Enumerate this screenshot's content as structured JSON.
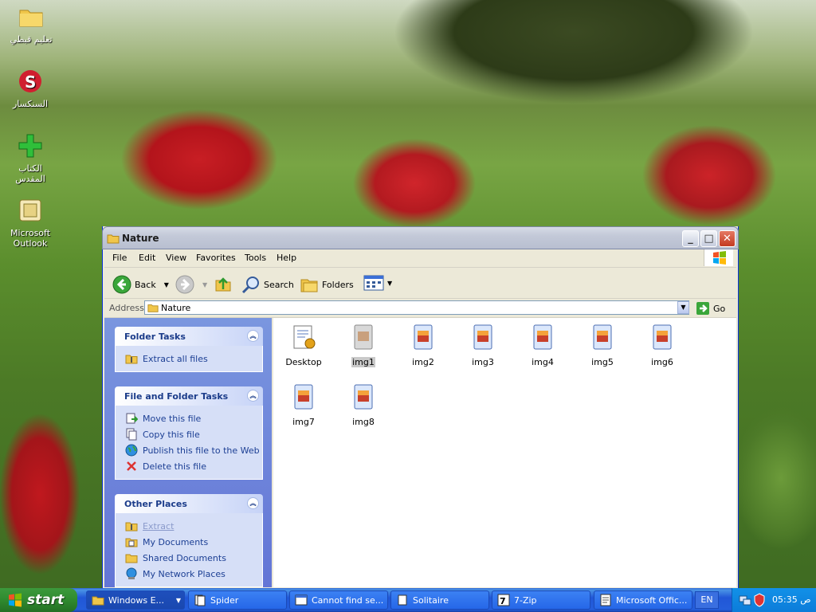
{
  "desktop": {
    "icons": [
      {
        "label": "تعليم قبطي",
        "icon": "folder-icon"
      },
      {
        "label": "السنكسار",
        "icon": "s-app-icon"
      },
      {
        "label": "الكتاب المقدس",
        "icon": "bible-app-icon"
      },
      {
        "label": "Microsoft Outlook",
        "icon": "outlook-icon"
      }
    ]
  },
  "window": {
    "title": "Nature",
    "menu": [
      "File",
      "Edit",
      "View",
      "Favorites",
      "Tools",
      "Help"
    ],
    "toolbar": {
      "back": "Back",
      "search": "Search",
      "folders": "Folders"
    },
    "address": {
      "label": "Address",
      "value": "Nature",
      "go": "Go"
    },
    "panels": {
      "folder_tasks": {
        "title": "Folder Tasks",
        "items": [
          "Extract all files"
        ]
      },
      "file_folder_tasks": {
        "title": "File and Folder Tasks",
        "items": [
          "Move this file",
          "Copy this file",
          "Publish this file to the Web",
          "Delete this file"
        ]
      },
      "other_places": {
        "title": "Other Places",
        "items": [
          "Extract",
          "My Documents",
          "Shared Documents",
          "My Network Places"
        ]
      }
    },
    "files": [
      "Desktop",
      "img1",
      "img2",
      "img3",
      "img4",
      "img5",
      "img6",
      "img7",
      "img8"
    ],
    "selected_file": "img1"
  },
  "taskbar": {
    "start": "start",
    "tasks": [
      "Windows E...",
      "Spider",
      "Cannot find se...",
      "Solitaire",
      "7-Zip",
      "Microsoft Offic..."
    ],
    "language": "EN",
    "clock": "05:35 ص"
  },
  "colors": {
    "xp_blue": "#245edb",
    "start_green": "#2f8a2f",
    "panel_blue": "#6375d6",
    "close_red": "#c43a20"
  }
}
